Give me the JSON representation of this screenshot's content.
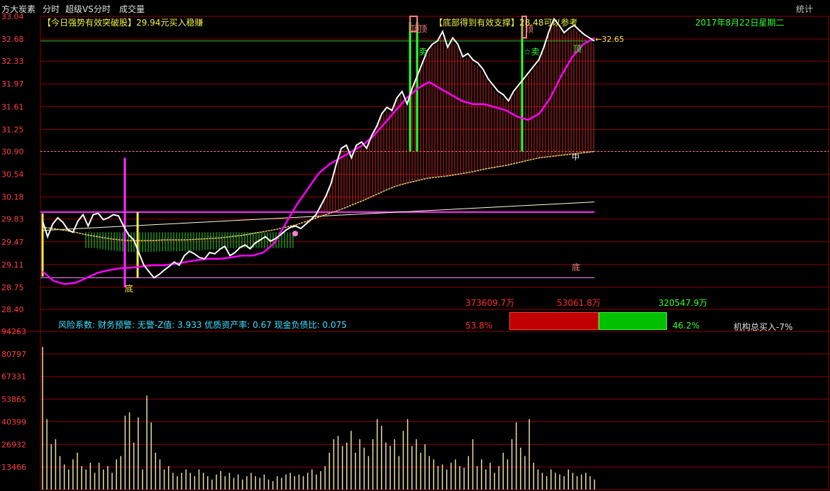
{
  "header": {
    "stock_name": "方大炭素",
    "tabs": [
      "分时",
      "超级VS分时",
      "成交量"
    ],
    "stat_button": "统计",
    "date": "2017年8月22日星期二"
  },
  "annotations": {
    "buy_signal": "【今日强势有效突破股】29.94元买入稳赚",
    "support_signal": "【底部得到有效支撑】28.48可以参考",
    "last_price_label": "←32.65",
    "top_marks": [
      "顶",
      "顶",
      "顶",
      "顶"
    ],
    "sell_marks": [
      "卖",
      "☆卖"
    ],
    "bottom_marks": [
      "底",
      "底"
    ],
    "cross_mark": "中"
  },
  "panel_stats": {
    "amount_total": "373609.7万",
    "amount_buy": "53061.8万",
    "amount_sell": "320547.9万",
    "buy_pct": "53.8%",
    "sell_pct": "46.2%",
    "institution": "机构总买入-7%",
    "risk_text": "风险系数: 财务预警: 无警-Z值: 3.933 优质资产率: 0.67 现金负债比: 0.075"
  },
  "colors": {
    "price_line": "#ffffff",
    "avg_line": "#e8d070",
    "indicator_line": "#ff00ff",
    "up_bars": "#ff3030",
    "down_bars": "#30ff30",
    "grid": "#8b0000",
    "volume": "#e8e0a0"
  },
  "chart_data": [
    {
      "type": "line",
      "title": "",
      "y_ticks": [
        "33.04",
        "32.68",
        "32.33",
        "31.97",
        "31.61",
        "31.25",
        "30.90",
        "30.54",
        "30.18",
        "29.83",
        "29.47",
        "29.11",
        "28.75",
        "28.40"
      ],
      "ylim": [
        28.4,
        33.04
      ],
      "series": [
        {
          "values": [
            29.8,
            29.55,
            29.75,
            29.85,
            29.78,
            29.66,
            29.62,
            29.8,
            29.9,
            29.72,
            29.9,
            29.92,
            29.82,
            29.85,
            29.9,
            29.88,
            29.72,
            29.58,
            29.5,
            29.3,
            29.1,
            29.0,
            28.9,
            28.95,
            29.02,
            29.08,
            29.15,
            29.1,
            29.25,
            29.32,
            29.28,
            29.22,
            29.2,
            29.3,
            29.28,
            29.35,
            29.4,
            29.25,
            29.3,
            29.38,
            29.42,
            29.36,
            29.45,
            29.5,
            29.55,
            29.48,
            29.52,
            29.58,
            29.65,
            29.7,
            29.72,
            29.68,
            29.75,
            29.82,
            29.9,
            30.05,
            30.2,
            30.4,
            30.7,
            30.95,
            31.0,
            30.8,
            31.0,
            31.05,
            30.95,
            31.15,
            31.3,
            31.5,
            31.6,
            31.55,
            31.75,
            31.85,
            31.65,
            31.9,
            32.1,
            32.3,
            32.5,
            32.6,
            32.65,
            32.8,
            32.55,
            32.7,
            32.6,
            32.4,
            32.45,
            32.35,
            32.3,
            32.2,
            32.05,
            31.95,
            31.85,
            31.8,
            31.7,
            31.85,
            31.95,
            32.05,
            32.15,
            32.25,
            32.35,
            32.55,
            32.8,
            33.0,
            32.9,
            32.78,
            32.85,
            32.9,
            32.82,
            32.75,
            32.7,
            32.65
          ]
        },
        {
          "values": [
            29.7,
            29.68,
            29.65,
            29.62,
            29.58,
            29.55,
            29.52,
            29.5,
            29.49,
            29.49,
            29.49,
            29.5,
            29.5,
            29.5,
            29.51,
            29.52,
            29.53,
            29.55,
            29.57,
            29.6,
            29.63,
            29.66,
            29.7,
            29.74,
            29.8,
            29.86,
            29.92,
            29.98,
            30.05,
            30.12,
            30.2,
            30.28,
            30.35,
            30.4,
            30.44,
            30.48,
            30.5,
            30.52,
            30.55,
            30.58,
            30.62,
            30.65,
            30.68,
            30.72,
            30.76,
            30.8,
            30.82,
            30.84,
            30.86,
            30.88,
            30.9
          ]
        },
        {
          "values": [
            29.0,
            28.85,
            28.8,
            28.82,
            28.9,
            28.98,
            29.02,
            29.05,
            29.06,
            29.08,
            29.1,
            29.1,
            29.12,
            29.15,
            29.18,
            29.2,
            29.2,
            29.22,
            29.25,
            29.25,
            29.3,
            29.45,
            29.75,
            30.05,
            30.3,
            30.55,
            30.7,
            30.8,
            30.9,
            31.0,
            31.15,
            31.35,
            31.55,
            31.75,
            31.9,
            32.0,
            31.9,
            31.8,
            31.7,
            31.65,
            31.65,
            31.6,
            31.55,
            31.45,
            31.4,
            31.5,
            31.75,
            32.1,
            32.4,
            32.6,
            32.7
          ]
        }
      ]
    },
    {
      "type": "bar",
      "title": "",
      "y_ticks": [
        "94263",
        "80797",
        "67331",
        "53865",
        "40399",
        "26932",
        "13466"
      ],
      "ylim": [
        0,
        94263
      ],
      "values": [
        85000,
        42000,
        27000,
        30000,
        20000,
        15000,
        12000,
        18000,
        22000,
        14000,
        12000,
        16000,
        10000,
        16000,
        12000,
        14000,
        10000,
        18000,
        20000,
        44000,
        46000,
        28000,
        43000,
        12000,
        56000,
        40000,
        22000,
        18000,
        12000,
        14000,
        10000,
        8000,
        10000,
        12000,
        10000,
        8000,
        12000,
        10000,
        8000,
        6000,
        9000,
        11000,
        8000,
        10000,
        7000,
        9000,
        6000,
        8000,
        10000,
        8000,
        7000,
        9000,
        6000,
        5000,
        8000,
        7000,
        9000,
        10000,
        8000,
        9000,
        8000,
        10000,
        12000,
        9000,
        11000,
        14000,
        22000,
        30000,
        32000,
        26000,
        28000,
        35000,
        22000,
        30000,
        25000,
        20000,
        30000,
        42000,
        38000,
        28000,
        26000,
        30000,
        20000,
        35000,
        42000,
        26000,
        30000,
        22000,
        27000,
        20000,
        18000,
        14000,
        15000,
        12000,
        16000,
        18000,
        14000,
        13000,
        20000,
        30000,
        14000,
        18000,
        12000,
        16000,
        10000,
        14000,
        22000,
        18000,
        30000,
        40000,
        25000,
        20000,
        42000,
        16000,
        12000,
        10000,
        8000,
        12000,
        10000,
        9000,
        8000,
        12000,
        10000,
        8000,
        9000,
        10000,
        8000,
        6000
      ]
    }
  ]
}
